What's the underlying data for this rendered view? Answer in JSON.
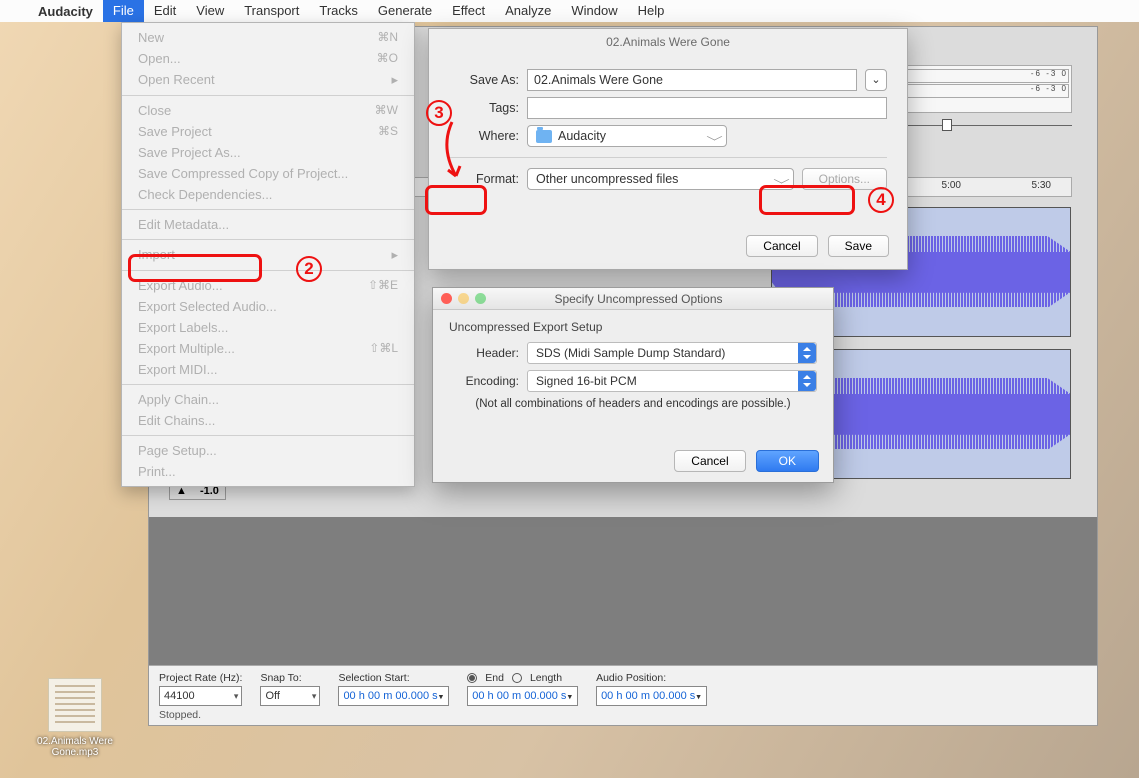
{
  "menubar": {
    "app": "Audacity",
    "items": [
      "File",
      "Edit",
      "View",
      "Transport",
      "Tracks",
      "Generate",
      "Effect",
      "Analyze",
      "Window",
      "Help"
    ],
    "active": "File"
  },
  "fileMenu": {
    "groups": [
      [
        {
          "label": "New",
          "sc": "⌘N"
        },
        {
          "label": "Open...",
          "sc": "⌘O"
        },
        {
          "label": "Open Recent",
          "sub": true
        }
      ],
      [
        {
          "label": "Close",
          "sc": "⌘W"
        },
        {
          "label": "Save Project",
          "sc": "⌘S"
        },
        {
          "label": "Save Project As..."
        },
        {
          "label": "Save Compressed Copy of Project..."
        },
        {
          "label": "Check Dependencies..."
        }
      ],
      [
        {
          "label": "Edit Metadata..."
        }
      ],
      [
        {
          "label": "Import",
          "sub": true
        }
      ],
      [
        {
          "label": "Export Audio...",
          "sc": "⇧⌘E"
        },
        {
          "label": "Export Selected Audio..."
        },
        {
          "label": "Export Labels..."
        },
        {
          "label": "Export Multiple...",
          "sc": "⇧⌘L"
        },
        {
          "label": "Export MIDI..."
        }
      ],
      [
        {
          "label": "Apply Chain..."
        },
        {
          "label": "Edit Chains..."
        }
      ],
      [
        {
          "label": "Page Setup..."
        },
        {
          "label": "Print..."
        }
      ]
    ]
  },
  "exportSheet": {
    "title": "02.Animals Were Gone",
    "saveAsLabel": "Save As:",
    "saveAsValue": "02.Animals Were Gone",
    "tagsLabel": "Tags:",
    "tagsValue": "",
    "whereLabel": "Where:",
    "whereValue": "Audacity",
    "formatLabel": "Format:",
    "formatValue": "Other uncompressed files",
    "optionsLabel": "Options...",
    "cancel": "Cancel",
    "save": "Save"
  },
  "optionsDialog": {
    "title": "Specify Uncompressed Options",
    "subtitle": "Uncompressed Export Setup",
    "headerLabel": "Header:",
    "headerValue": "SDS (Midi Sample Dump Standard)",
    "encodingLabel": "Encoding:",
    "encodingValue": "Signed 16-bit PCM",
    "note": "(Not all combinations of headers and encodings are possible.)",
    "cancel": "Cancel",
    "ok": "OK"
  },
  "ruler": {
    "t1": "5:00",
    "t2": "5:30"
  },
  "meters": {
    "ticks": "-6  -3   0"
  },
  "trackPanel": {
    "neg": "-1.0"
  },
  "statusBar": {
    "rateLabel": "Project Rate (Hz):",
    "rateValue": "44100",
    "snapLabel": "Snap To:",
    "snapValue": "Off",
    "selStartLabel": "Selection Start:",
    "selValue": "00 h 00 m 00.000 s",
    "endLabel": "End",
    "lengthLabel": "Length",
    "audioPosLabel": "Audio Position:",
    "status": "Stopped."
  },
  "annotations": {
    "n2": "2",
    "n3": "3",
    "n4": "4"
  },
  "desktopFile": {
    "name": "02.Animals Were Gone.mp3"
  }
}
